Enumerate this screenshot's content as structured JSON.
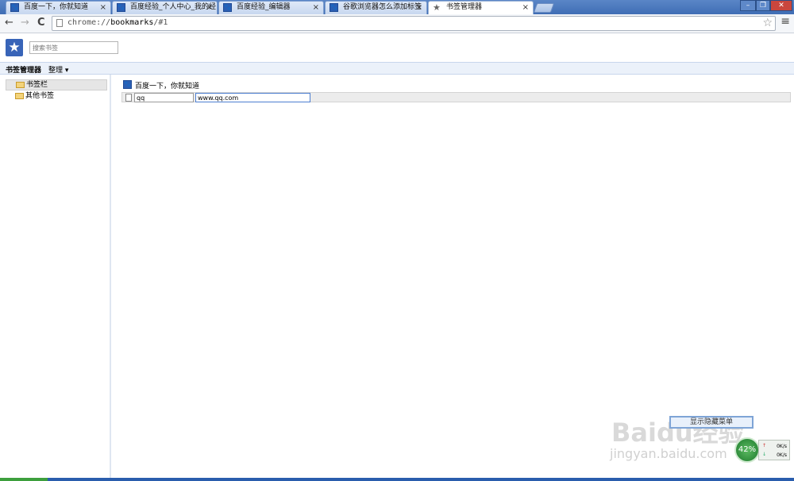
{
  "tabs": [
    {
      "label": "百度一下，你就知道",
      "icon": "baidu-paw-icon"
    },
    {
      "label": "百度经验_个人中心_我的经",
      "icon": "baidu-paw-icon"
    },
    {
      "label": "百度经验_编辑器",
      "icon": "baidu-paw-icon"
    },
    {
      "label": "谷歌浏览器怎么添加标签",
      "icon": "baidu-paw-icon"
    },
    {
      "label": "书签管理器",
      "icon": "star-icon",
      "active": true
    }
  ],
  "tab_close": "×",
  "window_controls": {
    "minimize": "–",
    "restore": "❐",
    "close": "✕"
  },
  "toolbar": {
    "back": "←",
    "forward": "→",
    "reload": "C",
    "url_scheme": "chrome://",
    "url_host": "bookmarks",
    "url_path": "/#1",
    "star": "☆",
    "menu": "≡"
  },
  "manager": {
    "logo_glyph": "★",
    "search_placeholder": "搜索书签",
    "title": "书签管理器",
    "organize_label": "整理 ▾"
  },
  "tree": [
    {
      "label": "书签栏",
      "selected": true
    },
    {
      "label": "其他书签",
      "selected": false
    }
  ],
  "list": {
    "row1_title": "百度一下，你就知道",
    "edit_name": "qq",
    "edit_url": "www.qq.com"
  },
  "overlay_button": "显示隐藏菜单",
  "watermark": {
    "brand": "Baidu经验",
    "site": "jingyan.baidu.com"
  },
  "net_monitor": {
    "percent": "42%",
    "up": "0K/s",
    "down": "0K/s",
    "up_arrow": "↑",
    "down_arrow": "↓"
  },
  "colors": {
    "accent": "#3864b8",
    "tab_strip": "#4a79be"
  }
}
